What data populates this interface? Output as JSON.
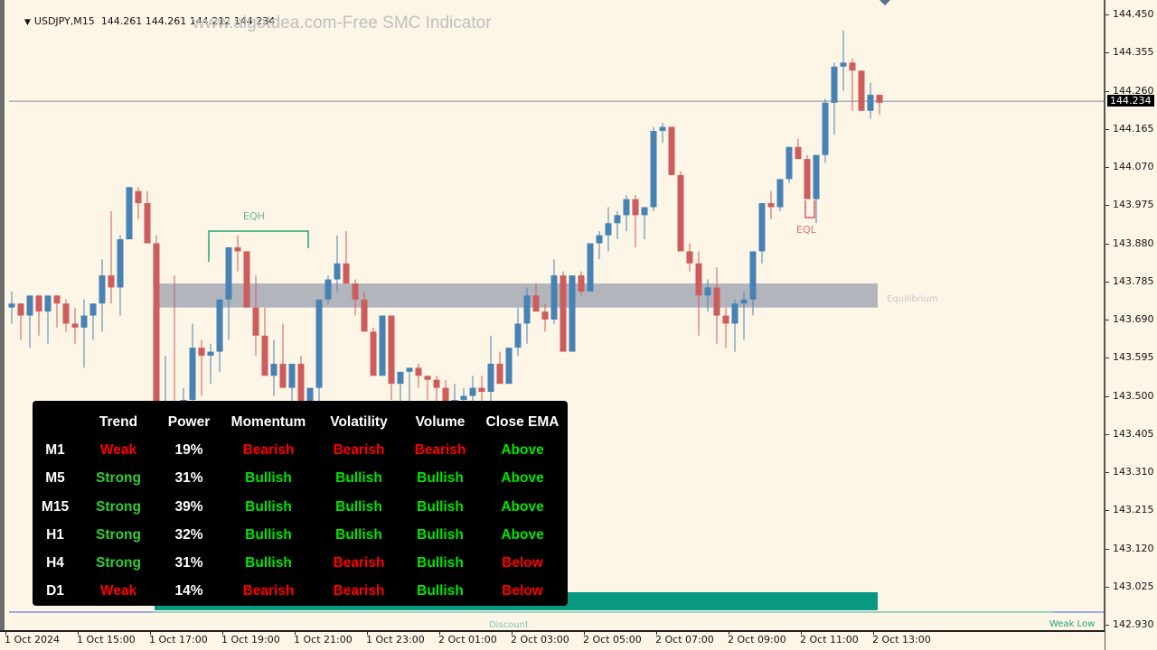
{
  "header": {
    "symbol": "USDJPY,M15",
    "ohlc": "144.261 144.261 144.212 144.234",
    "watermark": "www.algotdea.com-Free SMC Indicator"
  },
  "colors": {
    "background": "#fdf5e6",
    "bull": "#4682b4",
    "bear": "#cd5c5c",
    "equilibrium_zone": "#b3b5bd",
    "discount_zone": "#099880",
    "eqh_line": "#1fa37a",
    "eql_line": "#e05a5a",
    "bid_line": "#7a8a99"
  },
  "price_axis": {
    "labels": [
      "144.450",
      "144.355",
      "144.260",
      "144.165",
      "144.070",
      "143.975",
      "143.880",
      "143.785",
      "143.690",
      "143.595",
      "143.500",
      "143.405",
      "143.310",
      "143.215",
      "143.120",
      "143.025",
      "142.930"
    ],
    "current_price": "144.234"
  },
  "time_axis": {
    "labels": [
      "1 Oct 2024",
      "1 Oct 15:00",
      "1 Oct 17:00",
      "1 Oct 19:00",
      "1 Oct 21:00",
      "1 Oct 23:00",
      "2 Oct 01:00",
      "2 Oct 03:00",
      "2 Oct 05:00",
      "2 Oct 07:00",
      "2 Oct 09:00",
      "2 Oct 11:00",
      "2 Oct 13:00"
    ]
  },
  "annotations": {
    "eqh": "EQH",
    "eql": "EQL",
    "equilibrium": "Equilibrium",
    "discount": "Discount",
    "weak_low": "Weak Low"
  },
  "chart_data": {
    "type": "candlestick",
    "symbol": "USDJPY",
    "timeframe": "M15",
    "ylim": [
      142.93,
      144.45
    ],
    "zones": {
      "equilibrium": [
        143.72,
        143.78
      ],
      "discount": [
        142.96,
        143.01
      ],
      "eqh_level": 143.905,
      "eql_level": 143.95
    },
    "candles": [
      [
        143.72,
        143.76,
        143.68,
        143.73
      ],
      [
        143.73,
        143.73,
        143.64,
        143.7
      ],
      [
        143.7,
        143.73,
        143.62,
        143.75
      ],
      [
        143.75,
        143.75,
        143.65,
        143.71
      ],
      [
        143.71,
        143.74,
        143.63,
        143.75
      ],
      [
        143.75,
        143.75,
        143.67,
        143.73
      ],
      [
        143.73,
        143.74,
        143.66,
        143.68
      ],
      [
        143.68,
        143.72,
        143.63,
        143.67
      ],
      [
        143.67,
        143.74,
        143.57,
        143.7
      ],
      [
        143.7,
        143.7,
        143.64,
        143.73
      ],
      [
        143.73,
        143.84,
        143.66,
        143.8
      ],
      [
        143.8,
        143.96,
        143.73,
        143.77
      ],
      [
        143.77,
        143.9,
        143.7,
        143.89
      ],
      [
        143.89,
        143.99,
        143.97,
        144.02
      ],
      [
        144.01,
        144.02,
        143.94,
        143.98
      ],
      [
        143.98,
        144.01,
        143.92,
        143.88
      ],
      [
        143.88,
        143.9,
        143.4,
        143.44
      ],
      [
        143.44,
        143.6,
        143.46,
        143.48
      ],
      [
        143.48,
        143.8,
        143.43,
        143.46
      ],
      [
        143.46,
        143.52,
        143.43,
        143.49
      ],
      [
        143.49,
        143.68,
        143.47,
        143.62
      ],
      [
        143.62,
        143.64,
        143.5,
        143.6
      ],
      [
        143.6,
        143.63,
        143.53,
        143.61
      ],
      [
        143.61,
        143.72,
        143.56,
        143.74
      ],
      [
        143.74,
        143.78,
        143.64,
        143.87
      ],
      [
        143.87,
        143.9,
        143.81,
        143.86
      ],
      [
        143.86,
        143.86,
        143.8,
        143.72
      ],
      [
        143.72,
        143.8,
        143.6,
        143.65
      ],
      [
        143.65,
        143.72,
        143.61,
        143.55
      ],
      [
        143.55,
        143.64,
        143.5,
        143.58
      ],
      [
        143.58,
        143.68,
        143.52,
        143.52
      ],
      [
        143.52,
        143.54,
        143.44,
        143.58
      ],
      [
        143.58,
        143.6,
        143.43,
        143.43
      ],
      [
        143.43,
        143.48,
        143.4,
        143.52
      ],
      [
        143.52,
        143.59,
        143.46,
        143.74
      ],
      [
        143.74,
        143.8,
        143.73,
        143.79
      ],
      [
        143.79,
        143.9,
        143.76,
        143.83
      ],
      [
        143.83,
        143.91,
        143.81,
        143.78
      ],
      [
        143.78,
        143.79,
        143.7,
        143.74
      ],
      [
        143.74,
        143.76,
        143.68,
        143.66
      ],
      [
        143.66,
        143.67,
        143.55,
        143.55
      ],
      [
        143.55,
        143.7,
        143.55,
        143.7
      ],
      [
        143.7,
        143.7,
        143.49,
        143.53
      ],
      [
        143.53,
        143.56,
        143.48,
        143.56
      ],
      [
        143.56,
        143.57,
        143.48,
        143.57
      ],
      [
        143.57,
        143.58,
        143.52,
        143.55
      ],
      [
        143.55,
        143.55,
        143.49,
        143.54
      ],
      [
        143.54,
        143.55,
        143.48,
        143.52
      ],
      [
        143.52,
        143.54,
        143.49,
        143.48
      ],
      [
        143.48,
        143.53,
        143.43,
        143.49
      ],
      [
        143.49,
        143.52,
        143.48,
        143.5
      ],
      [
        143.5,
        143.55,
        143.48,
        143.52
      ],
      [
        143.52,
        143.55,
        143.48,
        143.51
      ],
      [
        143.51,
        143.65,
        143.48,
        143.58
      ],
      [
        143.58,
        143.61,
        143.56,
        143.53
      ],
      [
        143.53,
        143.6,
        143.58,
        143.62
      ],
      [
        143.62,
        143.72,
        143.6,
        143.68
      ],
      [
        143.68,
        143.77,
        143.63,
        143.75
      ],
      [
        143.75,
        143.78,
        143.72,
        143.71
      ],
      [
        143.71,
        143.73,
        143.66,
        143.69
      ],
      [
        143.69,
        143.84,
        143.68,
        143.8
      ],
      [
        143.8,
        143.81,
        143.7,
        143.61
      ],
      [
        143.61,
        143.8,
        143.61,
        143.8
      ],
      [
        143.8,
        143.81,
        143.75,
        143.76
      ],
      [
        143.76,
        143.87,
        143.76,
        143.88
      ],
      [
        143.88,
        143.91,
        143.84,
        143.9
      ],
      [
        143.9,
        143.97,
        143.86,
        143.93
      ],
      [
        143.93,
        143.96,
        143.89,
        143.95
      ],
      [
        143.95,
        144.0,
        143.91,
        143.99
      ],
      [
        143.99,
        144.0,
        143.87,
        143.95
      ],
      [
        143.95,
        143.95,
        143.89,
        143.97
      ],
      [
        143.97,
        144.17,
        143.96,
        144.16
      ],
      [
        144.16,
        144.18,
        144.13,
        144.17
      ],
      [
        144.17,
        144.15,
        144.07,
        144.05
      ],
      [
        144.05,
        144.06,
        143.88,
        143.86
      ],
      [
        143.86,
        143.88,
        143.81,
        143.83
      ],
      [
        143.83,
        143.86,
        143.65,
        143.75
      ],
      [
        143.75,
        143.79,
        143.71,
        143.77
      ],
      [
        143.77,
        143.82,
        143.63,
        143.7
      ],
      [
        143.7,
        143.72,
        143.62,
        143.68
      ],
      [
        143.68,
        143.74,
        143.61,
        143.73
      ],
      [
        143.73,
        143.76,
        143.64,
        143.74
      ],
      [
        143.74,
        143.77,
        143.7,
        143.86
      ],
      [
        143.86,
        143.92,
        143.83,
        143.98
      ],
      [
        143.98,
        144.01,
        143.94,
        143.97
      ],
      [
        143.97,
        144.03,
        143.96,
        144.04
      ],
      [
        144.04,
        144.12,
        144.03,
        144.12
      ],
      [
        144.12,
        144.14,
        144.09,
        144.09
      ],
      [
        144.09,
        144.1,
        144.0,
        143.99
      ],
      [
        143.99,
        144.09,
        143.93,
        144.1
      ],
      [
        144.1,
        144.24,
        144.08,
        144.23
      ],
      [
        144.23,
        144.33,
        144.15,
        144.32
      ],
      [
        144.32,
        144.41,
        144.26,
        144.33
      ],
      [
        144.33,
        144.34,
        144.21,
        144.31
      ],
      [
        144.31,
        144.31,
        144.21,
        144.21
      ],
      [
        144.21,
        144.28,
        144.19,
        144.25
      ],
      [
        144.25,
        144.25,
        144.2,
        144.23
      ]
    ]
  },
  "strength_panel": {
    "headers": [
      "",
      "Trend",
      "Power",
      "Momentum",
      "Volatility",
      "Volume",
      "Close EMA"
    ],
    "rows": [
      {
        "tf": "M1",
        "trend": "Weak",
        "power": "19%",
        "momentum": "Bearish",
        "volatility": "Bearish",
        "volume": "Bearish",
        "close_ema": "Above"
      },
      {
        "tf": "M5",
        "trend": "Strong",
        "power": "31%",
        "momentum": "Bullish",
        "volatility": "Bullish",
        "volume": "Bullish",
        "close_ema": "Above"
      },
      {
        "tf": "M15",
        "trend": "Strong",
        "power": "39%",
        "momentum": "Bullish",
        "volatility": "Bullish",
        "volume": "Bullish",
        "close_ema": "Above"
      },
      {
        "tf": "H1",
        "trend": "Strong",
        "power": "32%",
        "momentum": "Bullish",
        "volatility": "Bullish",
        "volume": "Bullish",
        "close_ema": "Above"
      },
      {
        "tf": "H4",
        "trend": "Strong",
        "power": "31%",
        "momentum": "Bullish",
        "volatility": "Bearish",
        "volume": "Bullish",
        "close_ema": "Below"
      },
      {
        "tf": "D1",
        "trend": "Weak",
        "power": "14%",
        "momentum": "Bearish",
        "volatility": "Bearish",
        "volume": "Bullish",
        "close_ema": "Below"
      }
    ]
  }
}
